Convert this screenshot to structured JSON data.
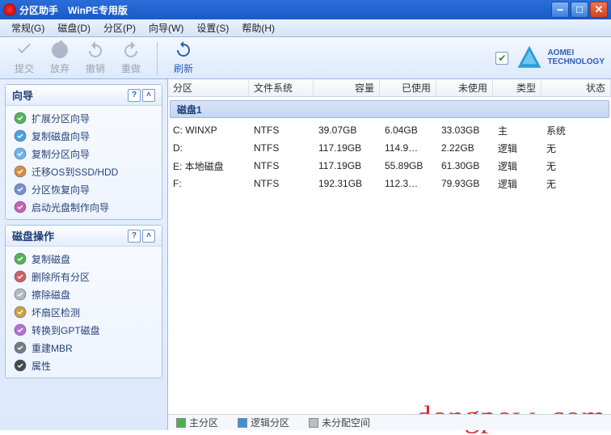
{
  "title": {
    "app": "分区助手",
    "edition": "WinPE专用版"
  },
  "menu": {
    "general": "常规(G)",
    "disk": "磁盘(D)",
    "part": "分区(P)",
    "wizard": "向导(W)",
    "settings": "设置(S)",
    "help": "帮助(H)"
  },
  "toolbar": {
    "commit": "提交",
    "discard": "放弃",
    "undo": "撤销",
    "redo": "重做",
    "refresh": "刷新",
    "brand": "AOMEI",
    "brand_sub": "TECHNOLOGY"
  },
  "panels": {
    "wizard": {
      "title": "向导",
      "items": [
        "扩展分区向导",
        "复制磁盘向导",
        "复制分区向导",
        "迁移OS到SSD/HDD",
        "分区恢复向导",
        "启动光盘制作向导"
      ]
    },
    "diskops": {
      "title": "磁盘操作",
      "items": [
        "复制磁盘",
        "删除所有分区",
        "擦除磁盘",
        "坏扇区检测",
        "转换到GPT磁盘",
        "重建MBR",
        "属性"
      ]
    }
  },
  "columns": {
    "partition": "分区",
    "fs": "文件系统",
    "capacity": "容量",
    "used": "已使用",
    "free": "未使用",
    "type": "类型",
    "status": "状态"
  },
  "disk_label": "磁盘1",
  "rows": [
    {
      "name": "C: WINXP",
      "fs": "NTFS",
      "cap": "39.07GB",
      "used": "6.04GB",
      "free": "33.03GB",
      "type": "主",
      "status": "系统"
    },
    {
      "name": "D:",
      "fs": "NTFS",
      "cap": "117.19GB",
      "used": "114.9…",
      "free": "2.22GB",
      "type": "逻辑",
      "status": "无"
    },
    {
      "name": "E: 本地磁盘",
      "fs": "NTFS",
      "cap": "117.19GB",
      "used": "55.89GB",
      "free": "61.30GB",
      "type": "逻辑",
      "status": "无"
    },
    {
      "name": "F:",
      "fs": "NTFS",
      "cap": "192.31GB",
      "used": "112.3…",
      "free": "79.93GB",
      "type": "逻辑",
      "status": "无"
    }
  ],
  "legend": {
    "primary": "主分区",
    "logical": "逻辑分区",
    "unalloc": "未分配空间"
  },
  "colors": {
    "primary": "#4caf50",
    "logical": "#3f8fd8",
    "unalloc": "#bdbdbd"
  },
  "watermark": "dongpow. com"
}
